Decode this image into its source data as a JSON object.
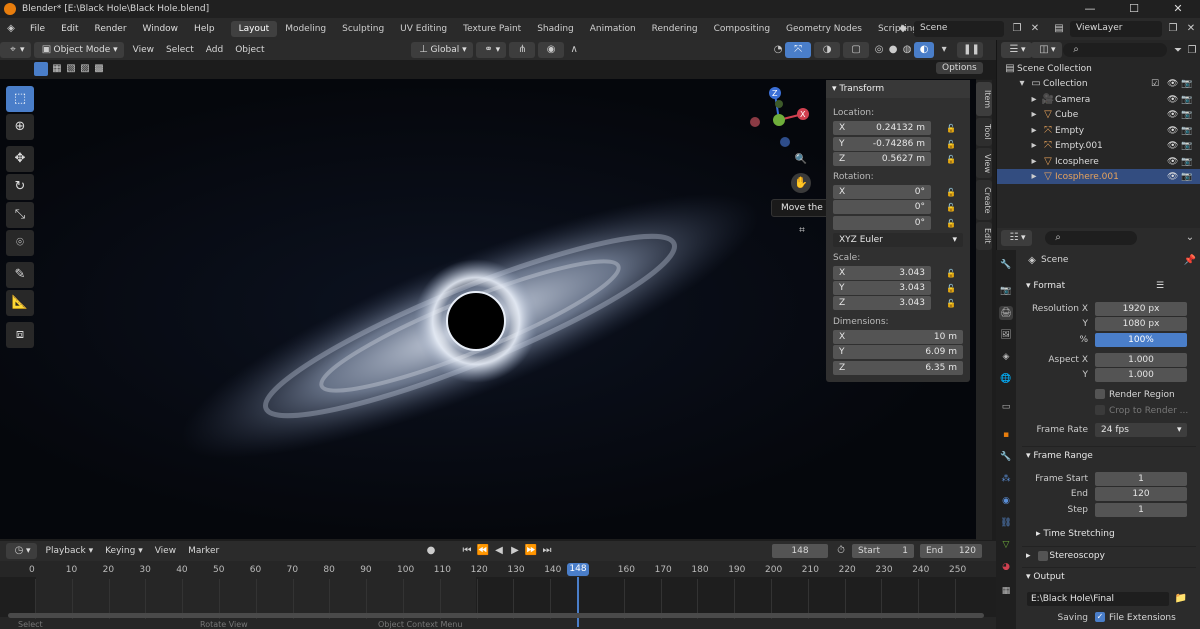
{
  "window": {
    "title": "Blender* [E:\\Black Hole\\Black Hole.blend]",
    "min": "—",
    "max": "☐",
    "close": "✕"
  },
  "menu": [
    "File",
    "Edit",
    "Render",
    "Window",
    "Help"
  ],
  "workspaces": [
    "Layout",
    "Modeling",
    "Sculpting",
    "UV Editing",
    "Texture Paint",
    "Shading",
    "Animation",
    "Rendering",
    "Compositing",
    "Geometry Nodes",
    "Scripting"
  ],
  "topright": {
    "scene": "Scene",
    "view_layer": "ViewLayer"
  },
  "viewport_header": {
    "mode": "Object Mode",
    "menus": [
      "View",
      "Select",
      "Add",
      "Object"
    ],
    "orientation": "Global",
    "options": "Options"
  },
  "tooltip": "Move the view",
  "transform": {
    "title": "Transform",
    "location_label": "Location:",
    "location": [
      {
        "axis": "X",
        "value": "0.24132 m"
      },
      {
        "axis": "Y",
        "value": "-0.74286 m"
      },
      {
        "axis": "Z",
        "value": "0.5627 m"
      }
    ],
    "rotation_label": "Rotation:",
    "rotation": [
      {
        "axis": "X",
        "value": "0°"
      },
      {
        "axis": "",
        "value": "0°"
      },
      {
        "axis": "",
        "value": "0°"
      }
    ],
    "rotation_mode": "XYZ Euler",
    "scale_label": "Scale:",
    "scale": [
      {
        "axis": "X",
        "value": "3.043"
      },
      {
        "axis": "Y",
        "value": "3.043"
      },
      {
        "axis": "Z",
        "value": "3.043"
      }
    ],
    "dimensions_label": "Dimensions:",
    "dimensions": [
      {
        "axis": "X",
        "value": "10 m"
      },
      {
        "axis": "Y",
        "value": "6.09 m"
      },
      {
        "axis": "Z",
        "value": "6.35 m"
      }
    ]
  },
  "npanel_tabs": [
    "Item",
    "Tool",
    "View",
    "Create",
    "Edit"
  ],
  "timeline": {
    "menus": [
      "Playback",
      "Keying",
      "View",
      "Marker"
    ],
    "current_frame": "148",
    "start_label": "Start",
    "start": "1",
    "end_label": "End",
    "end": "120",
    "ticks": [
      "0",
      "10",
      "20",
      "30",
      "40",
      "50",
      "60",
      "70",
      "80",
      "90",
      "100",
      "110",
      "120",
      "130",
      "140",
      "148",
      "160",
      "170",
      "180",
      "190",
      "200",
      "210",
      "220",
      "230",
      "240",
      "250"
    ]
  },
  "status": [
    "Select",
    "Rotate View",
    "Object Context Menu"
  ],
  "outliner": {
    "root": "Scene Collection",
    "collection": "Collection",
    "items": [
      "Camera",
      "Cube",
      "Empty",
      "Empty.001",
      "Icosphere",
      "Icosphere.001"
    ]
  },
  "properties": {
    "scene": "Scene",
    "format_title": "Format",
    "resolution_x_label": "Resolution X",
    "resolution_x": "1920 px",
    "y_label": "Y",
    "resolution_y": "1080 px",
    "percent_label": "%",
    "percent": "100%",
    "aspect_x_label": "Aspect X",
    "aspect_x": "1.000",
    "aspect_y_label": "Y",
    "aspect_y": "1.000",
    "render_region": "Render Region",
    "crop": "Crop to Render ...",
    "frame_rate_label": "Frame Rate",
    "frame_rate": "24 fps",
    "frame_range_title": "Frame Range",
    "frame_start_label": "Frame Start",
    "frame_start": "1",
    "end_label": "End",
    "end": "120",
    "step_label": "Step",
    "step": "1",
    "time_stretching": "Time Stretching",
    "stereoscopy": "Stereoscopy",
    "output_title": "Output",
    "output_path": "E:\\Black Hole\\Final",
    "saving_label": "Saving",
    "file_extensions": "File Extensions"
  },
  "colors": {
    "accent": "#4a7ec9",
    "selected_row": "#334d80",
    "orange": "#e87d0d"
  }
}
